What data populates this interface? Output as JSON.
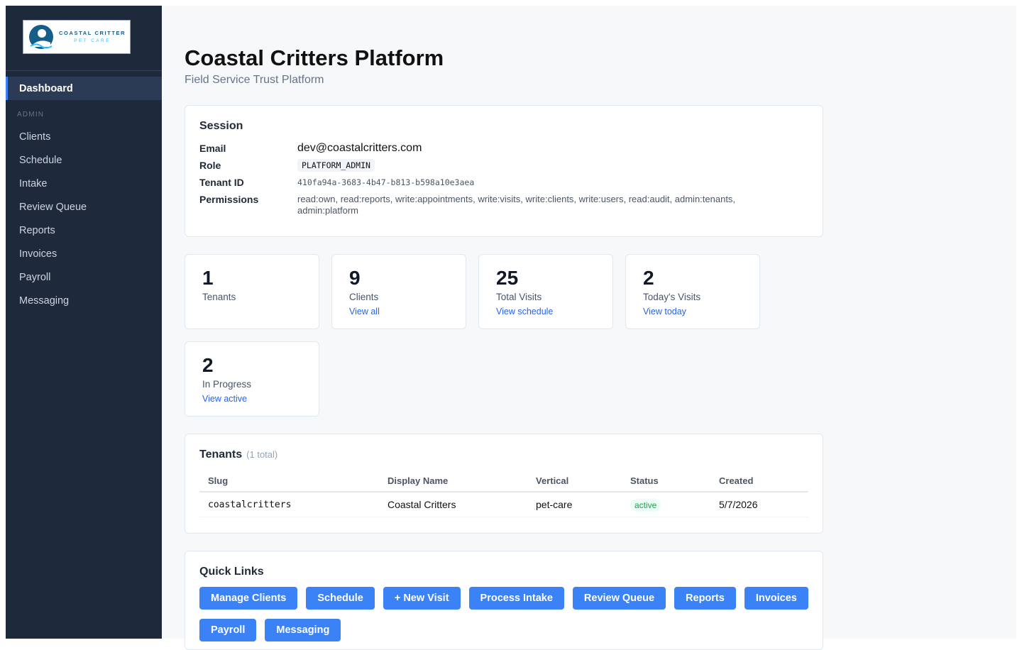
{
  "logo": {
    "line1": "COASTAL CRITTER",
    "line2": "PET CARE"
  },
  "sidebar": {
    "active": "Dashboard",
    "section": "ADMIN",
    "items": [
      "Clients",
      "Schedule",
      "Intake",
      "Review Queue",
      "Reports",
      "Invoices",
      "Payroll",
      "Messaging"
    ]
  },
  "header": {
    "title": "Coastal Critters Platform",
    "subtitle": "Field Service Trust Platform"
  },
  "session": {
    "title": "Session",
    "email_label": "Email",
    "email": "dev@coastalcritters.com",
    "role_label": "Role",
    "role": "PLATFORM_ADMIN",
    "tenant_label": "Tenant ID",
    "tenant_id": "410fa94a-3683-4b47-b813-b598a10e3aea",
    "perm_label": "Permissions",
    "permissions": "read:own, read:reports, write:appointments, write:visits, write:clients, write:users, read:audit, admin:tenants, admin:platform"
  },
  "stats": [
    {
      "value": "1",
      "label": "Tenants",
      "link": ""
    },
    {
      "value": "9",
      "label": "Clients",
      "link": "View all"
    },
    {
      "value": "25",
      "label": "Total Visits",
      "link": "View schedule"
    },
    {
      "value": "2",
      "label": "Today's Visits",
      "link": "View today"
    },
    {
      "value": "2",
      "label": "In Progress",
      "link": "View active"
    }
  ],
  "tenants": {
    "title": "Tenants",
    "total": "(1 total)",
    "columns": [
      "Slug",
      "Display Name",
      "Vertical",
      "Status",
      "Created"
    ],
    "rows": [
      {
        "slug": "coastalcritters",
        "name": "Coastal Critters",
        "vertical": "pet-care",
        "status": "active",
        "created": "5/7/2026"
      }
    ]
  },
  "quick_links": {
    "title": "Quick Links",
    "buttons": [
      "Manage Clients",
      "Schedule",
      "+ New Visit",
      "Process Intake",
      "Review Queue",
      "Reports",
      "Invoices",
      "Payroll",
      "Messaging"
    ]
  },
  "colors": {
    "sidebar": "#1e293b",
    "accent": "#3b82f6",
    "success": "#16a34a"
  }
}
